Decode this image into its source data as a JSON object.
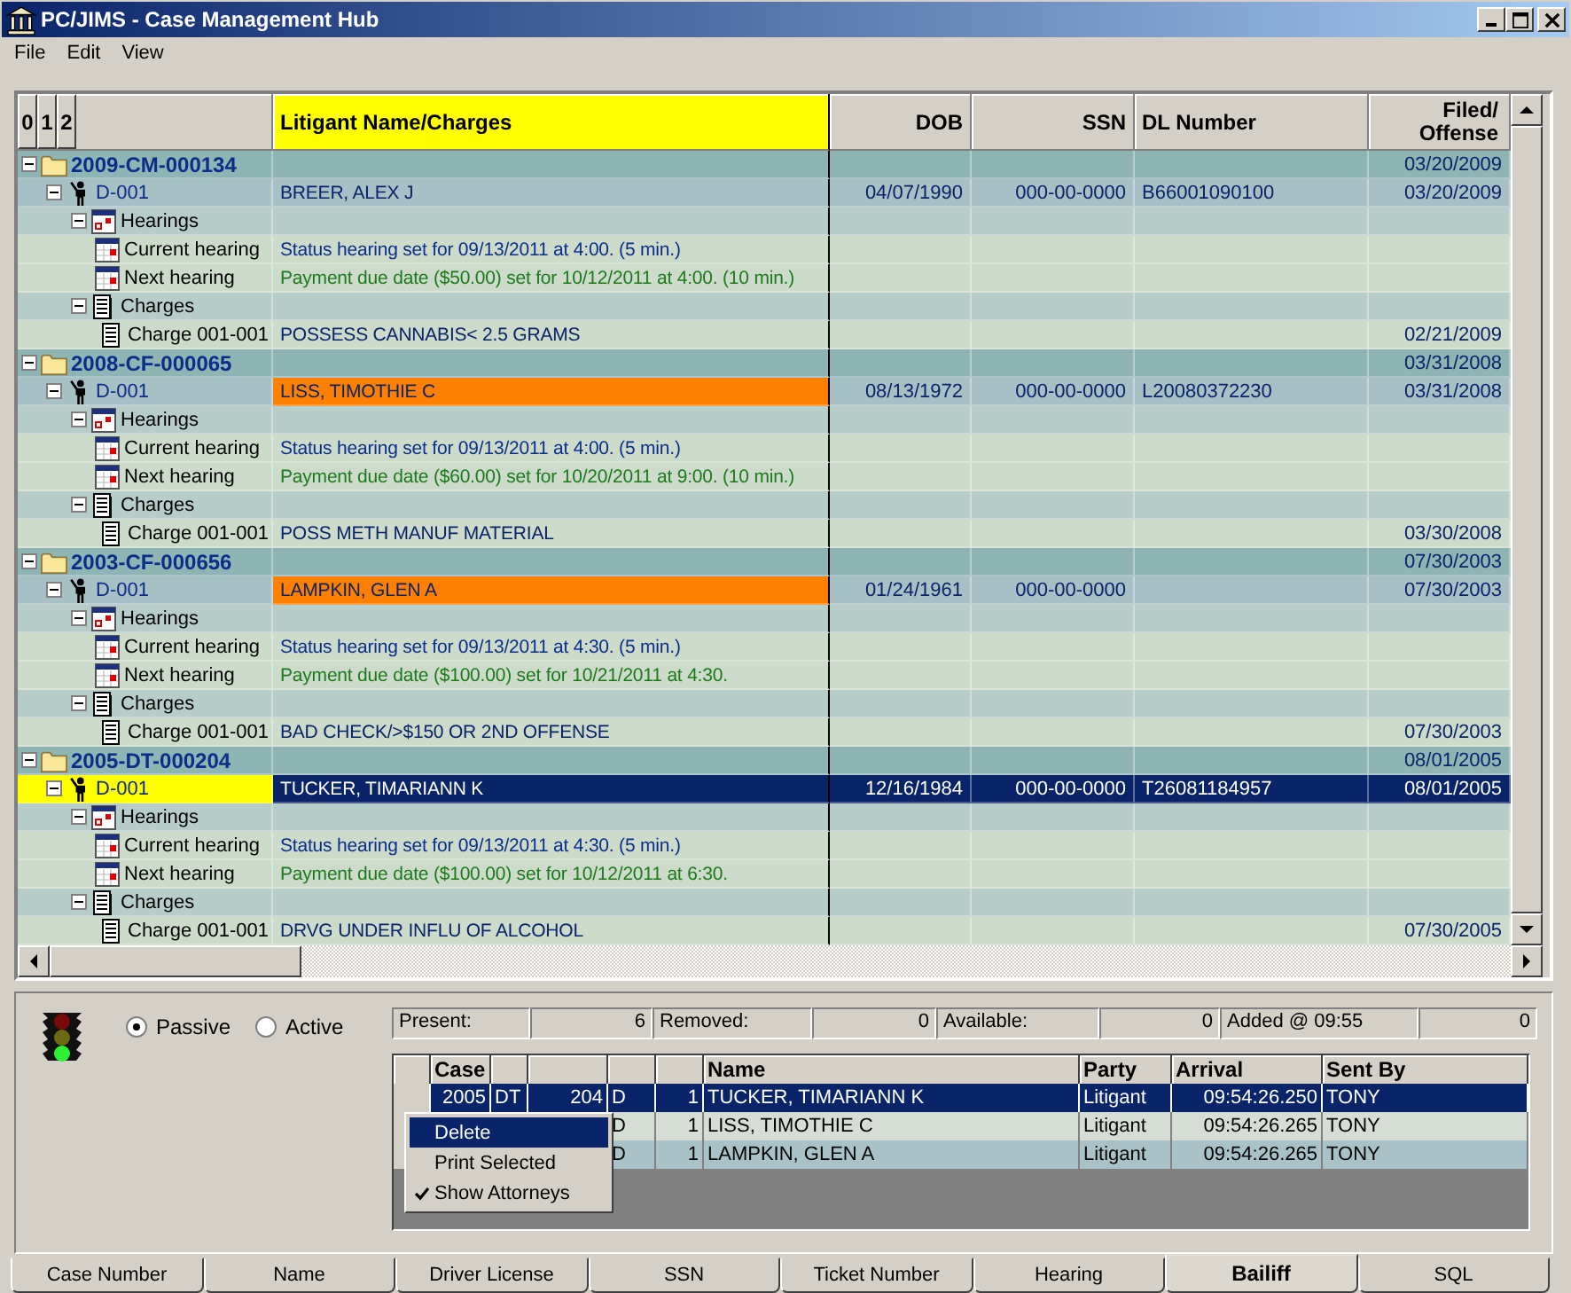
{
  "window": {
    "title": "PC/JIMS - Case Management Hub"
  },
  "menu": [
    "File",
    "Edit",
    "View"
  ],
  "grid": {
    "level_buttons": [
      "0",
      "1",
      "2"
    ],
    "columns": [
      "Litigant Name/Charges",
      "DOB",
      "SSN",
      "DL Number",
      "Filed/ Offense"
    ],
    "cases": [
      {
        "number": "2009-CM-000134",
        "filed": "03/20/2009",
        "expanded": true,
        "defendant": {
          "id": "D-001",
          "name": "BREER, ALEX J",
          "dob": "04/07/1990",
          "ssn": "000-00-0000",
          "dl": "B66001090100",
          "filed": "03/20/2009",
          "flagged": false,
          "selected": false,
          "expanded": true
        },
        "hearings": {
          "label": "Hearings",
          "expanded": true,
          "items": [
            {
              "label": "Current hearing",
              "text": "Status hearing set for 09/13/2011 at 4:00. (5 min.)",
              "kind": "current"
            },
            {
              "label": "Next hearing",
              "text": "Payment due date ($50.00) set for 10/12/2011 at 4:00. (10 min.)",
              "kind": "next"
            }
          ]
        },
        "charges": {
          "label": "Charges",
          "expanded": true,
          "items": [
            {
              "label": "Charge 001-001",
              "text": "POSSESS CANNABIS< 2.5 GRAMS",
              "date": "02/21/2009"
            }
          ]
        }
      },
      {
        "number": "2008-CF-000065",
        "filed": "03/31/2008",
        "expanded": true,
        "defendant": {
          "id": "D-001",
          "name": "LISS, TIMOTHIE C",
          "dob": "08/13/1972",
          "ssn": "000-00-0000",
          "dl": "L20080372230",
          "filed": "03/31/2008",
          "flagged": true,
          "selected": false,
          "expanded": true
        },
        "hearings": {
          "label": "Hearings",
          "expanded": true,
          "items": [
            {
              "label": "Current hearing",
              "text": "Status hearing set for 09/13/2011 at 4:00. (5 min.)",
              "kind": "current"
            },
            {
              "label": "Next hearing",
              "text": "Payment due date ($60.00) set for 10/20/2011 at 9:00. (10 min.)",
              "kind": "next"
            }
          ]
        },
        "charges": {
          "label": "Charges",
          "expanded": true,
          "items": [
            {
              "label": "Charge 001-001",
              "text": "POSS METH MANUF MATERIAL",
              "date": "03/30/2008"
            }
          ]
        }
      },
      {
        "number": "2003-CF-000656",
        "filed": "07/30/2003",
        "expanded": true,
        "defendant": {
          "id": "D-001",
          "name": "LAMPKIN, GLEN A",
          "dob": "01/24/1961",
          "ssn": "000-00-0000",
          "filed": "07/30/2003",
          "flagged": true,
          "selected": false,
          "expanded": true
        },
        "hearings": {
          "label": "Hearings",
          "expanded": true,
          "items": [
            {
              "label": "Current hearing",
              "text": "Status hearing set for 09/13/2011 at 4:30. (5 min.)",
              "kind": "current"
            },
            {
              "label": "Next hearing",
              "text": "Payment due date ($100.00) set for 10/21/2011 at 4:30.",
              "kind": "next"
            }
          ]
        },
        "charges": {
          "label": "Charges",
          "expanded": true,
          "items": [
            {
              "label": "Charge 001-001",
              "text": "BAD CHECK/>$150 OR 2ND OFFENSE",
              "date": "07/30/2003"
            }
          ]
        }
      },
      {
        "number": "2005-DT-000204",
        "filed": "08/01/2005",
        "expanded": true,
        "defendant": {
          "id": "D-001",
          "name": "TUCKER, TIMARIANN K",
          "dob": "12/16/1984",
          "ssn": "000-00-0000",
          "dl": "T26081184957",
          "filed": "08/01/2005",
          "flagged": false,
          "selected": true,
          "expanded": true
        },
        "hearings": {
          "label": "Hearings",
          "expanded": true,
          "items": [
            {
              "label": "Current hearing",
              "text": "Status hearing set for 09/13/2011 at 4:30. (5 min.)",
              "kind": "current"
            },
            {
              "label": "Next hearing",
              "text": "Payment due date ($100.00) set for 10/12/2011 at 6:30.",
              "kind": "next"
            }
          ]
        },
        "charges": {
          "label": "Charges",
          "expanded": true,
          "items": [
            {
              "label": "Charge 001-001",
              "text": "DRVG UNDER INFLU OF ALCOHOL",
              "date": "07/30/2005"
            }
          ]
        }
      }
    ]
  },
  "mode": [
    {
      "label": "Passive",
      "selected": true
    },
    {
      "label": "Active",
      "selected": false
    }
  ],
  "counters": [
    {
      "label": "Present:",
      "value": "6"
    },
    {
      "label": "Removed:",
      "value": "0"
    },
    {
      "label": "Available:",
      "value": "0"
    },
    {
      "label": "Added @ 09:55",
      "value": "0"
    }
  ],
  "queue": {
    "columns": [
      "Case",
      "Name",
      "Party",
      "Arrival",
      "Sent By"
    ],
    "rows": [
      {
        "case": "2005",
        "column_3": "DT",
        "column_4": "204",
        "column_5": "D",
        "column_6": "1",
        "name": "TUCKER, TIMARIANN K",
        "party": "Litigant",
        "arrival": "09:54:26.250",
        "sent_by": "TONY",
        "selected": true
      },
      {
        "column_5": "D",
        "column_6": "1",
        "name": "LISS, TIMOTHIE C",
        "party": "Litigant",
        "arrival": "09:54:26.265",
        "sent_by": "TONY",
        "selected": false
      },
      {
        "column_5": "D",
        "column_6": "1",
        "name": "LAMPKIN, GLEN A",
        "party": "Litigant",
        "arrival": "09:54:26.265",
        "sent_by": "TONY",
        "selected": false
      }
    ]
  },
  "context_menu": [
    {
      "label": "Delete",
      "selected": true,
      "checked": false
    },
    {
      "label": "Print Selected",
      "selected": false,
      "checked": false
    },
    {
      "label": "Show Attorneys",
      "selected": false,
      "checked": true
    }
  ],
  "tabs": [
    {
      "label": "Case Number",
      "selected": false
    },
    {
      "label": "Name",
      "selected": false
    },
    {
      "label": "Driver License",
      "selected": false
    },
    {
      "label": "SSN",
      "selected": false
    },
    {
      "label": "Ticket Number",
      "selected": false
    },
    {
      "label": "Hearing",
      "selected": false
    },
    {
      "label": "Bailiff",
      "selected": true
    },
    {
      "label": "SQL",
      "selected": false
    }
  ]
}
